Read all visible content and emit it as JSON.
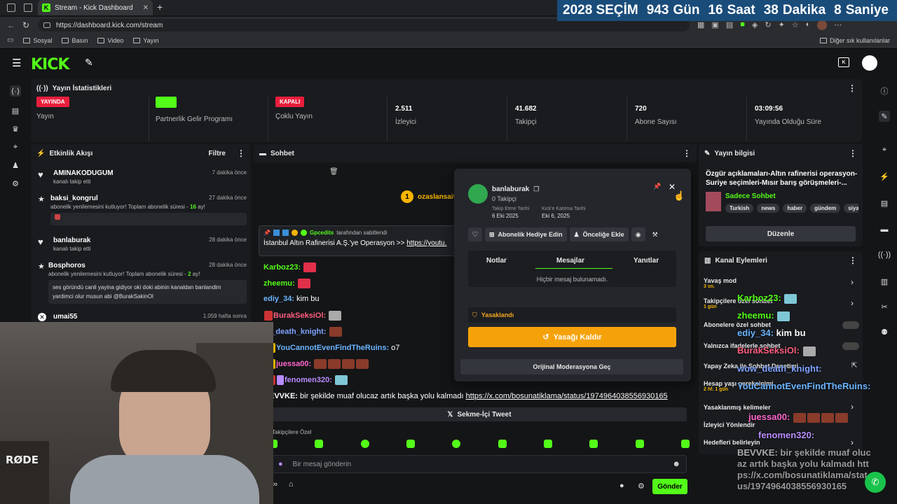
{
  "browser": {
    "tab_title": "Stream - Kick Dashboard",
    "url": "https://dashboard.kick.com/stream",
    "bookmarks": [
      "Sosyal",
      "Basın",
      "Video",
      "Yayın"
    ],
    "bookmarks_right": "Diğer sık kullanılanlar"
  },
  "countdown": {
    "year_label": "2028 SEÇİM",
    "days": "943",
    "days_label": "Gün",
    "hours": "16",
    "hours_label": "Saat",
    "minutes": "38",
    "minutes_label": "Dakika",
    "seconds": "8",
    "seconds_label": "Saniye"
  },
  "stats": {
    "title": "Yayın İstatistikleri",
    "items": [
      {
        "badge": "YAYINDA",
        "label": "Yayın",
        "badge_color": "#e91e3c"
      },
      {
        "badge": "",
        "label": "Partnerlik Gelir Programı",
        "badge_color": "#53fc18"
      },
      {
        "badge": "KAPALI",
        "label": "Çoklu Yayın",
        "badge_color": "#e91e3c"
      },
      {
        "value": "2.511",
        "label": "İzleyici"
      },
      {
        "value": "41.682",
        "label": "Takipçi"
      },
      {
        "value": "720",
        "label": "Abone Sayısı"
      },
      {
        "value": "03:09:56",
        "label": "Yayında Olduğu Süre"
      }
    ]
  },
  "activity": {
    "title": "Etkinlik Akışı",
    "filter": "Filtre",
    "items": [
      {
        "name": "AMINAKODUGUM",
        "sub": "kanalı takip etti",
        "time": "7 dakika önce"
      },
      {
        "name": "baksi_kongrul",
        "sub": "abonelik yenilemesini kutluyor! Toplam abonelik süresi - ",
        "months": "16",
        "sub_end": " ay!",
        "time": "27 dakika önce"
      },
      {
        "name": "banlaburak",
        "sub": "kanalı takip etti",
        "time": "28 dakika önce"
      },
      {
        "name": "Bosphoros",
        "sub": "abonelik yenilemesini kutluyor! Toplam abonelik süresi - ",
        "months": "2",
        "sub_end": " ay!",
        "time": "28 dakika önce",
        "message": "ses göründü canli yayina gidiyor oki doki abinin kanaldan banlandim yardimci olur musun abi @BurakSakinOl"
      },
      {
        "name": "umai55",
        "sub": "",
        "time": "1.059 hafta sonra"
      }
    ]
  },
  "chat": {
    "title": "Sohbet",
    "host_user": "ozaslansait",
    "host_count": "1",
    "pinned_by": "Gpcedits",
    "pinned_suffix": "tarafından sabitlendi",
    "pinned_text": "İstanbul Altın Rafinerisi A.Ş.'ye Operasyon >> ",
    "pinned_link": "https://youtu.",
    "lines": [
      {
        "user": "Karboz23:",
        "text": "",
        "color": "#53fc18"
      },
      {
        "user": "zheemu:",
        "text": "",
        "color": "#53fc18"
      },
      {
        "user": "ediy_34:",
        "text": " kim bu",
        "color": "#6ab4ff"
      },
      {
        "user": "BurakSeksiOl:",
        "text": "",
        "color": "#ff5e7e"
      },
      {
        "user": "ow_death_knight:",
        "text": "",
        "color": "#7ea1ff"
      },
      {
        "user": "YouCannotEvenFindTheRuins:",
        "text": " o7",
        "color": "#6ab4ff"
      },
      {
        "user": "juessa00:",
        "text": "",
        "color": "#ff66cc"
      },
      {
        "user": "fenomen320:",
        "text": "",
        "color": "#b98cff"
      },
      {
        "user": "EVVKE:",
        "text": " bir şekilde muaf olucaz artık başka yolu kalmadı ",
        "link": "https://x.com/bosunatiklama/status/1974964038556930165",
        "color": "#ffffff"
      }
    ],
    "tweet_button": "Sekme-İçi Tweet",
    "followers_only": "Takipçilere Özel",
    "input_placeholder": "Bir mesaj gönderin",
    "send": "Gönder"
  },
  "popup": {
    "username": "banlaburak",
    "followers": "0 Takipçi",
    "follow_date_label": "Takip Etme Tarihi",
    "follow_date": "6 Eki 2025",
    "join_date_label": "Kick'e Katılma Tarihi",
    "join_date": "Eki 6, 2025",
    "gift_sub": "Abonelik Hediye Edin",
    "priority": "Önceliğe Ekle",
    "tabs": [
      "Notlar",
      "Mesajlar",
      "Yanıtlar"
    ],
    "no_messages": "Hiçbir mesaj bulunamadı.",
    "banned": "Yasaklandı",
    "unban": "Yasağı Kaldır",
    "original_mod": "Orijinal Moderasyona Geç"
  },
  "stream_info": {
    "title": "Yayın bilgisi",
    "stream_title": "Özgür açıklamaları-Altın rafinerisi operasyon-Suriye seçimleri-Mısır barış görüşmeleri-...",
    "category": "Sadece Sohbet",
    "tags": [
      "Turkish",
      "news",
      "haber",
      "gündem",
      "siya"
    ],
    "edit": "Düzenle"
  },
  "channel_actions": {
    "title": "Kanal Eylemleri",
    "items": [
      {
        "label": "Yavaş mod",
        "sub": "3 sn.",
        "control": "chevron"
      },
      {
        "label": "Takipçilere özel sohbet",
        "sub": "1 gün",
        "control": "chevron"
      },
      {
        "label": "Abonelere özel sohbet",
        "sub": "",
        "control": "toggle"
      },
      {
        "label": "Yalnızca ifadelerle sohbet",
        "sub": "",
        "control": "toggle"
      },
      {
        "label": "Yapay Zeka ile Sohbet Denetimi",
        "sub": "",
        "control": "external"
      },
      {
        "label": "Hesap yaşı gereksinimi",
        "sub": "2 hf. 1 gün",
        "control": "chevron"
      },
      {
        "label": "Yasaklanmış kelimeler",
        "sub": "",
        "control": "chevron"
      },
      {
        "label": "İzleyici Yönlendir",
        "sub": "",
        "control": "none"
      },
      {
        "label": "Hedefleri belirleyin",
        "sub": "",
        "control": "chevron"
      }
    ]
  },
  "overlay_chat": [
    {
      "user": "Karboz23:",
      "text": "",
      "color": "#53fc18"
    },
    {
      "user": "zheemu:",
      "text": "",
      "color": "#53fc18"
    },
    {
      "user": "ediy_34:",
      "text": " kim bu",
      "color": "#6ab4ff"
    },
    {
      "user": "BurakSeksiOl:",
      "text": "",
      "color": "#ff5e7e"
    },
    {
      "user": "wow_death_knight:",
      "text": "",
      "color": "#7ea1ff"
    },
    {
      "user": "YouCannotEvenFindTheRuins:",
      "text": "",
      "color": "#6ab4ff"
    },
    {
      "user": "juessa00:",
      "text": "",
      "color": "#ff66cc"
    },
    {
      "user": "fenomen320:",
      "text": "",
      "color": "#b98cff"
    },
    {
      "user": "BEVVKE:",
      "text": " bir şekilde muaf olucaz artık başka yolu kalmadı https://x.com/bosunatiklama/status/1974964038556930165",
      "color": "#cfcfcf"
    }
  ],
  "camera": {
    "mic_brand": "RØDE"
  }
}
